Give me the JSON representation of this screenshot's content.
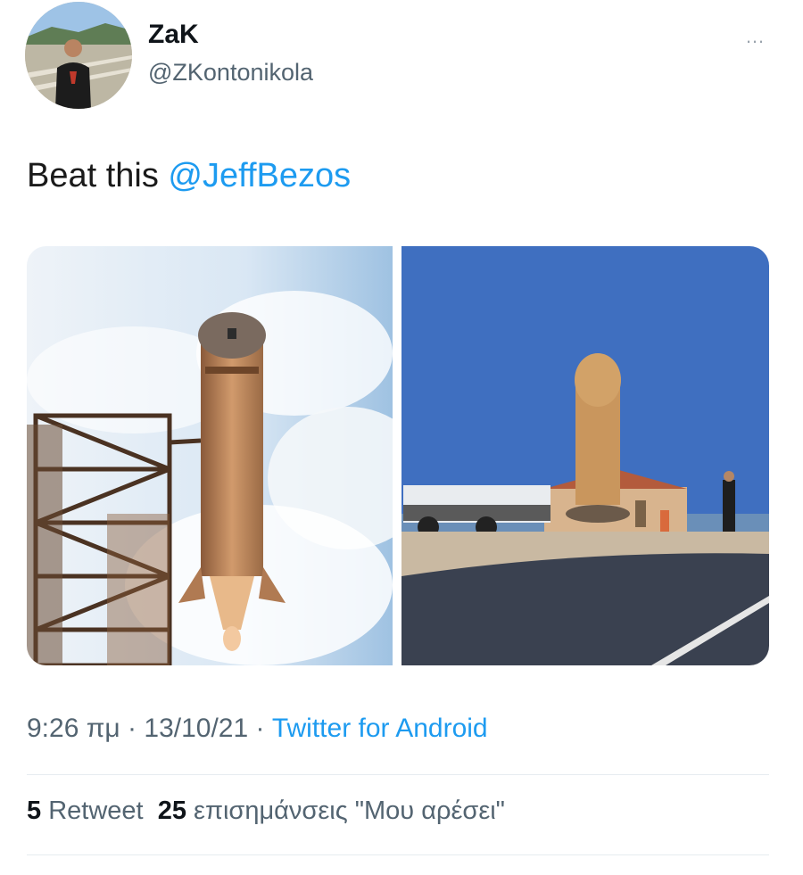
{
  "user": {
    "display_name": "ZaK",
    "handle": "@ZKontonikola"
  },
  "more_icon": "…",
  "tweet": {
    "text": "Beat this ",
    "mention": "@JeffBezos"
  },
  "media": {
    "left_image": "rocket-launch-photo",
    "right_image": "roadside-statue-photo"
  },
  "meta": {
    "time": "9:26 πμ",
    "separator_1": " · ",
    "date": "13/10/21",
    "separator_2": " · ",
    "source": "Twitter for Android"
  },
  "stats": {
    "retweets_count": "5",
    "retweets_label": "Retweet",
    "likes_count": "25",
    "likes_label": "επισημάνσεις \"Μου αρέσει\""
  },
  "colors": {
    "accent": "#1d9bf0",
    "secondary_text": "#536471"
  }
}
